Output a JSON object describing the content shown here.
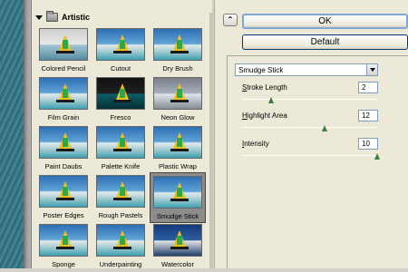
{
  "gallery": {
    "title": "Artistic",
    "filters": [
      {
        "label": "Colored Pencil",
        "style": "pencil"
      },
      {
        "label": "Cutout",
        "style": "normal"
      },
      {
        "label": "Dry Brush",
        "style": "normal"
      },
      {
        "label": "Film Grain",
        "style": "normal"
      },
      {
        "label": "Fresco",
        "style": "dark"
      },
      {
        "label": "Neon Glow",
        "style": "glow"
      },
      {
        "label": "Paint Daubs",
        "style": "normal"
      },
      {
        "label": "Palette Knife",
        "style": "normal"
      },
      {
        "label": "Plastic Wrap",
        "style": "normal"
      },
      {
        "label": "Poster Edges",
        "style": "normal"
      },
      {
        "label": "Rough Pastels",
        "style": "normal"
      },
      {
        "label": "Smudge Stick",
        "style": "normal",
        "selected": true
      },
      {
        "label": "Sponge",
        "style": "normal"
      },
      {
        "label": "Underpainting",
        "style": "normal"
      },
      {
        "label": "Watercolor",
        "style": "water"
      }
    ]
  },
  "options": {
    "collapse_icon": "double-chevron-up-icon",
    "ok_label": "OK",
    "default_label": "Default",
    "filter_select": "Smudge Stick",
    "params": [
      {
        "label_prefix": "",
        "label_key": "S",
        "label_rest": "troke Length",
        "value": "2",
        "slider_fraction": 0.2
      },
      {
        "label_prefix": "",
        "label_key": "H",
        "label_rest": "ighlight Area",
        "value": "12",
        "slider_fraction": 0.6
      },
      {
        "label_prefix": "",
        "label_key": "I",
        "label_rest": "ntensity",
        "value": "10",
        "slider_fraction": 1.0
      }
    ]
  }
}
